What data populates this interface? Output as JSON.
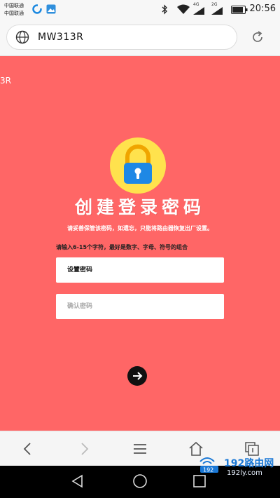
{
  "status_bar": {
    "carrier_1": "中国联通",
    "carrier_2": "中国联通",
    "net_1": "4G",
    "net_2": "2G",
    "time": "20:56"
  },
  "address_bar": {
    "url": "MW313R"
  },
  "page": {
    "fragment": "3R",
    "title": "创建登录密码",
    "subtitle": "请妥善保管该密码，如遗忘，只能将路由器恢复出厂设置。",
    "hint": "请输入6-15个字符，最好是数字、字母、符号的组合",
    "password_placeholder": "设置密码",
    "confirm_placeholder": "确认密码"
  },
  "watermark": {
    "brand": "192路由网",
    "url": "192ly.com",
    "badge": "192"
  },
  "colors": {
    "page_bg": "#ff6666",
    "lock_circle": "#ffe24d",
    "lock_body": "#1e88e5",
    "lock_shackle": "#f0a500"
  }
}
